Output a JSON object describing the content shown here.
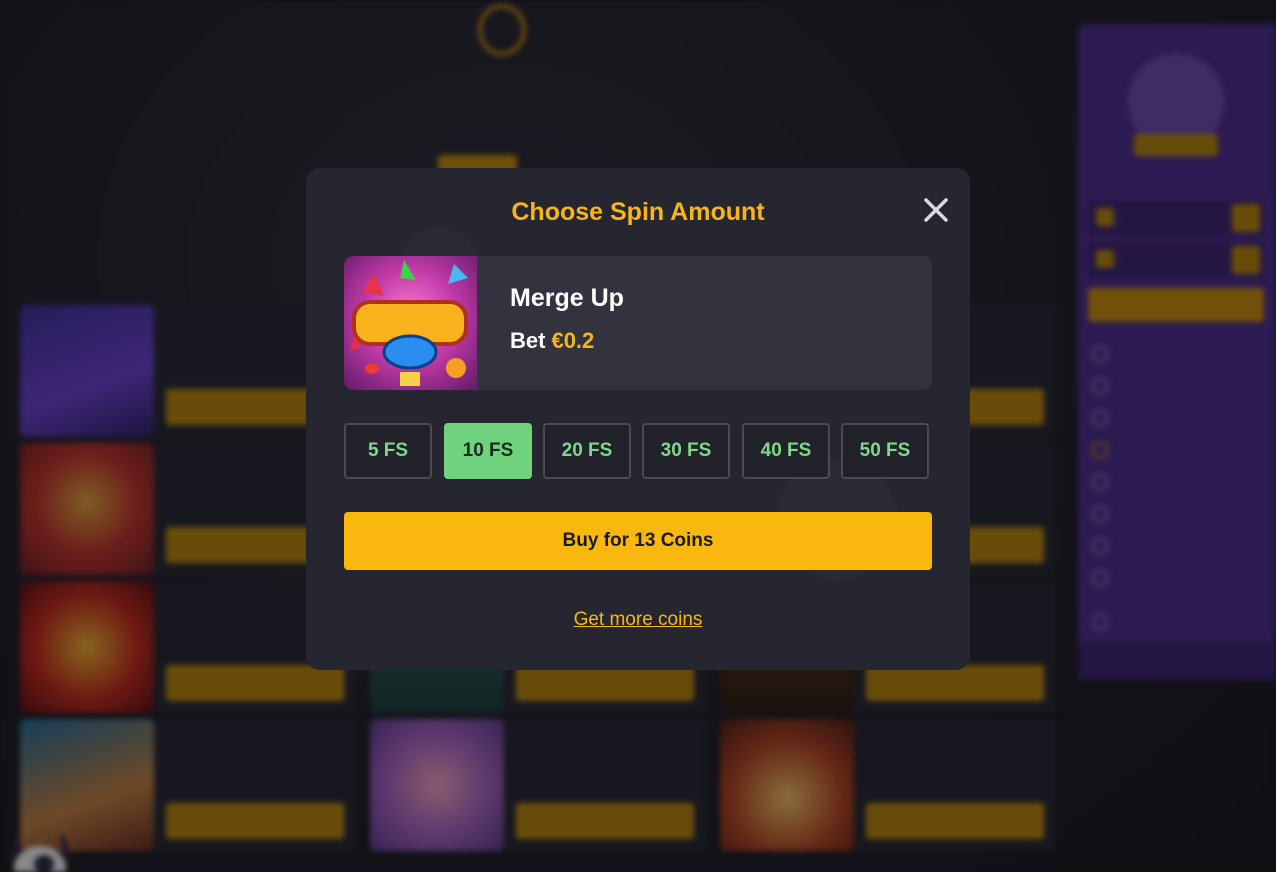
{
  "modal": {
    "title": "Choose Spin Amount",
    "game": {
      "name": "Merge Up",
      "bet_label": "Bet",
      "bet_value": "€0.2"
    },
    "spin_options": [
      "5 FS",
      "10 FS",
      "20 FS",
      "30 FS",
      "40 FS",
      "50 FS"
    ],
    "selected_option": "10 FS",
    "buy_label": "Buy for 13 Coins",
    "more_coins_label": "Get more coins"
  },
  "colors": {
    "accent": "#f8b514",
    "selected": "#6fd37d",
    "modal_bg": "#262630"
  }
}
